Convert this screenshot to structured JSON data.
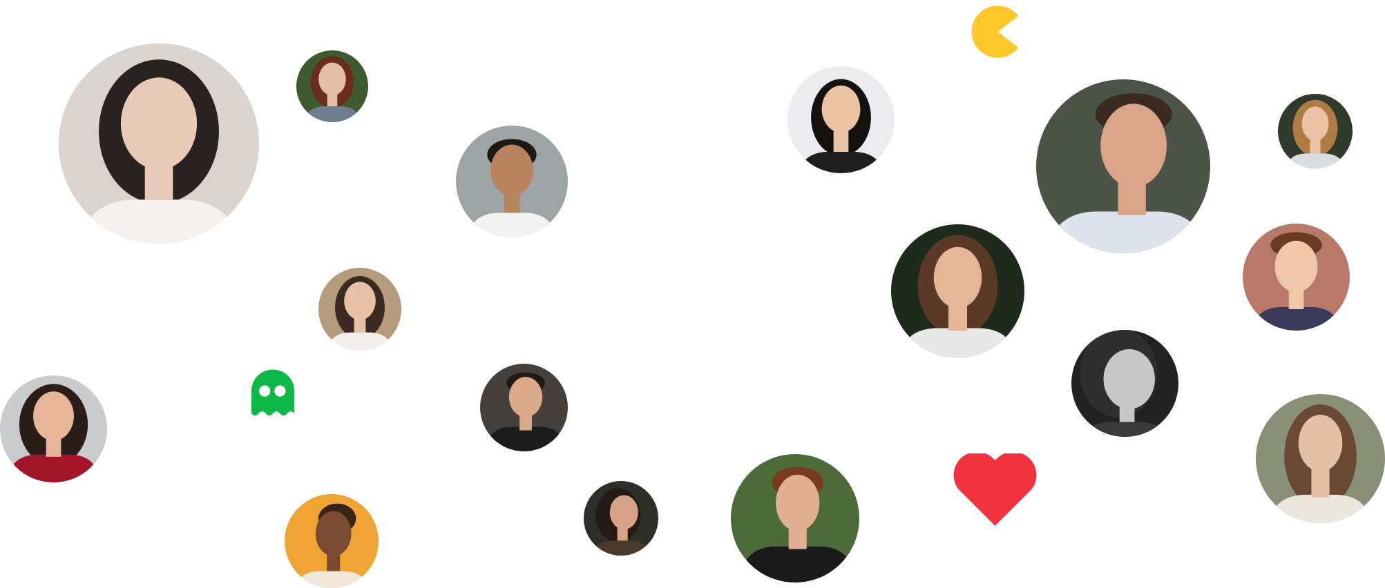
{
  "colors": {
    "pacman": "#FFC72C",
    "ghost": "#0BB848",
    "heart": "#F2333F",
    "background": "#FFFFFF"
  },
  "icons": {
    "pacman": "pacman-icon",
    "ghost": "ghost-icon",
    "heart": "heart-icon"
  },
  "avatars": [
    {
      "name": "avatar-woman-dark-hair-large",
      "bg": "#D9D4D0",
      "skin": "#E9C9B8",
      "hair": "#2A2220",
      "shirt": "#F4F1EE"
    },
    {
      "name": "avatar-woman-red-hair",
      "bg": "#3F5A2E",
      "skin": "#E3BFA8",
      "hair": "#6A2C1C",
      "shirt": "#6E7E8E"
    },
    {
      "name": "avatar-man-smiling-white-shirt",
      "bg": "#9EA3A6",
      "skin": "#B9835F",
      "hair": "#1C1815",
      "shirt": "#F2F2F2"
    },
    {
      "name": "avatar-woman-white-top",
      "bg": "#B59A7C",
      "skin": "#E7C2A6",
      "hair": "#3B2A22",
      "shirt": "#F2EEEA"
    },
    {
      "name": "avatar-woman-red-sweater",
      "bg": "#C9CBCD",
      "skin": "#E7B59A",
      "hair": "#2A1D18",
      "shirt": "#A3162A"
    },
    {
      "name": "avatar-man-black-shirt",
      "bg": "#45403C",
      "skin": "#D9A98A",
      "hair": "#1E1A18",
      "shirt": "#1C1C1C"
    },
    {
      "name": "avatar-woman-laughing",
      "bg": "#2B2F27",
      "skin": "#D7A285",
      "hair": "#241A16",
      "shirt": "#4A3A2E"
    },
    {
      "name": "avatar-woman-laughing-orange",
      "bg": "#F0A433",
      "skin": "#7A4A32",
      "hair": "#3A241A",
      "shirt": "#F2E8DA"
    },
    {
      "name": "avatar-man-red-beard",
      "bg": "#4C6A3A",
      "skin": "#E1B094",
      "hair": "#7A3A1E",
      "shirt": "#1A1A1A"
    },
    {
      "name": "avatar-woman-glasses",
      "bg": "#ECEBF0",
      "skin": "#E9C3A3",
      "hair": "#14110F",
      "shirt": "#1E1E1E"
    },
    {
      "name": "avatar-man-glasses-beard",
      "bg": "#4B5446",
      "skin": "#D9A487",
      "hair": "#3A2A20",
      "shirt": "#DCE3EA"
    },
    {
      "name": "avatar-woman-striped-shirt",
      "bg": "#1E2A1C",
      "skin": "#E4B597",
      "hair": "#5A3A26",
      "shirt": "#E8E8E8"
    },
    {
      "name": "avatar-woman-black-white",
      "bg": "#222222",
      "skin": "#C8C8C8",
      "hair": "#2E2E2E",
      "shirt": "#3A3A3A"
    },
    {
      "name": "avatar-woman-blonde",
      "bg": "#2E3B2A",
      "skin": "#EAC2A5",
      "hair": "#B07A45",
      "shirt": "#DADDE0"
    },
    {
      "name": "avatar-man-glasses-plaid",
      "bg": "#B8786A",
      "skin": "#F0C6AA",
      "hair": "#6A3A22",
      "shirt": "#3A3A5A"
    },
    {
      "name": "avatar-woman-long-hair-outdoors",
      "bg": "#8A9078",
      "skin": "#E3C0A6",
      "hair": "#6A4A34",
      "shirt": "#ECE6DE"
    }
  ]
}
